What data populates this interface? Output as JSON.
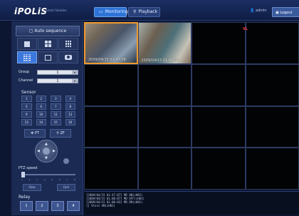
{
  "header": {
    "logo": "iPOLiS",
    "logo_sub": "Smart Solution",
    "monitoring": "Monitoring",
    "playback": "Playback",
    "user": "admin",
    "logout": "Logout"
  },
  "sidebar": {
    "auto_sequence": "Auto sequence",
    "group_label": "Group",
    "group_value": "1",
    "channel_label": "Channel",
    "channel_value": "1",
    "sensor_title": "Sensor",
    "sensors": [
      "1",
      "2",
      "3",
      "4",
      "5",
      "6",
      "7",
      "8",
      "9",
      "10",
      "11",
      "12",
      "13",
      "14",
      "15",
      "16"
    ],
    "ft_left": "PT",
    "ft_right": "ZF",
    "ptz_speed": "PTZ speed",
    "ticks": [
      "1",
      "2",
      "3",
      "4",
      "5",
      "6",
      "7",
      "8"
    ],
    "slow": "Slow",
    "fast": "Fast",
    "relay_title": "Relay",
    "relays": [
      "1",
      "2",
      "3",
      "4"
    ]
  },
  "video": {
    "cam1_time": "2009/04/15 01:47:08",
    "cam2_time": "2009/04/15 01:47:08",
    "vl": "VL"
  },
  "log_lines": [
    "[2009/04/15 01:47:07] MD ON(cH01)",
    "[2009/04/15 01:00:07] MD OFF(cH01)",
    "[2009/04/15 01:00:03] MD ON(cH01)",
    "[] Vloss ON(cH01)"
  ]
}
